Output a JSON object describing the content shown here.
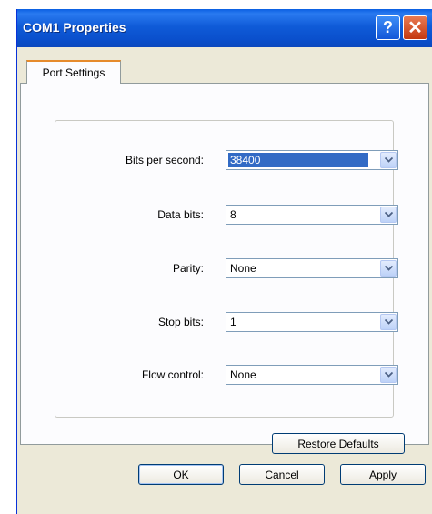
{
  "window": {
    "title": "COM1 Properties",
    "help_label": "?",
    "close_label": "✕"
  },
  "tabs": [
    {
      "label": "Port Settings"
    }
  ],
  "fields": [
    {
      "label": "Bits per second:",
      "value": "38400",
      "selected": true
    },
    {
      "label": "Data bits:",
      "value": "8",
      "selected": false
    },
    {
      "label": "Parity:",
      "value": "None",
      "selected": false
    },
    {
      "label": "Stop bits:",
      "value": "1",
      "selected": false
    },
    {
      "label": "Flow control:",
      "value": "None",
      "selected": false
    }
  ],
  "buttons": {
    "restore_defaults": "Restore Defaults",
    "ok": "OK",
    "cancel": "Cancel",
    "apply": "Apply"
  },
  "colors": {
    "titlebar": "#0a5fe2",
    "dialog_bg": "#ece9d8",
    "selection": "#316ac5"
  }
}
